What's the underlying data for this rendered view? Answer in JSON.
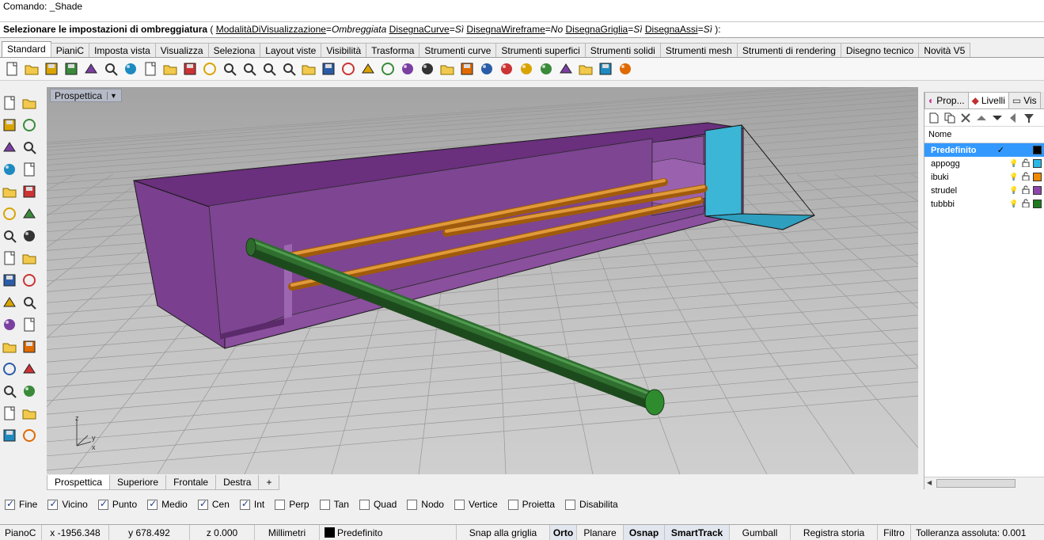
{
  "command": {
    "history": "Comando: _Shade",
    "prompt_bold": "Selezionare le impostazioni di ombreggiatura",
    "open_paren": " ( ",
    "options": [
      {
        "label": "ModalitàDiVisualizzazione",
        "value": "Ombreggiata"
      },
      {
        "label": "DisegnaCurve",
        "value": "Sì"
      },
      {
        "label": "DisegnaWireframe",
        "value": "No"
      },
      {
        "label": "DisegnaGriglia",
        "value": "Sì"
      },
      {
        "label": "DisegnaAssi",
        "value": "Sì"
      }
    ],
    "close_paren": " ):"
  },
  "tabs": [
    "Standard",
    "PianiC",
    "Imposta vista",
    "Visualizza",
    "Seleziona",
    "Layout viste",
    "Visibilità",
    "Trasforma",
    "Strumenti curve",
    "Strumenti superfici",
    "Strumenti solidi",
    "Strumenti mesh",
    "Strumenti di rendering",
    "Disegno tecnico",
    "Novità V5"
  ],
  "toolbar_icons": [
    "new-icon",
    "open-icon",
    "save-icon",
    "print-icon",
    "import-icon",
    "cut-icon",
    "copy-icon",
    "paste-icon",
    "undo-icon",
    "pan-icon",
    "move-view-icon",
    "zoom-icon",
    "zoom-window-icon",
    "zoom-extents-icon",
    "zoom-selected-icon",
    "rotate-view-icon",
    "four-viewports-icon",
    "car-icon",
    "cplane-icon",
    "circle-icon",
    "snap-icon",
    "light-icon",
    "lock-icon",
    "layer-icon",
    "color-wheel-icon",
    "sphere-icon",
    "shaded-sphere-icon",
    "rendered-sphere-icon",
    "cone-icon",
    "gear-icon",
    "grid-icon",
    "help-icon"
  ],
  "viewport": {
    "title": "Prospettica",
    "axis_x": "x",
    "axis_y": "y",
    "axis_z": "z"
  },
  "viewport_tabs": [
    "Prospettica",
    "Superiore",
    "Frontale",
    "Destra"
  ],
  "right_panel": {
    "tabs": [
      "Prop...",
      "Livelli",
      "Vis"
    ],
    "column_header": "Nome",
    "layers": [
      {
        "name": "Predefinito",
        "color": "#000000",
        "current": true
      },
      {
        "name": "appogg",
        "color": "#29b8e6",
        "current": false
      },
      {
        "name": "ibuki",
        "color": "#f08a00",
        "current": false
      },
      {
        "name": "strudel",
        "color": "#8e44ad",
        "current": false
      },
      {
        "name": "tubbbi",
        "color": "#1e7a1e",
        "current": false
      }
    ]
  },
  "osnaps": [
    {
      "label": "Fine",
      "checked": true
    },
    {
      "label": "Vicino",
      "checked": true
    },
    {
      "label": "Punto",
      "checked": true
    },
    {
      "label": "Medio",
      "checked": true
    },
    {
      "label": "Cen",
      "checked": true
    },
    {
      "label": "Int",
      "checked": true
    },
    {
      "label": "Perp",
      "checked": false
    },
    {
      "label": "Tan",
      "checked": false
    },
    {
      "label": "Quad",
      "checked": false
    },
    {
      "label": "Nodo",
      "checked": false
    },
    {
      "label": "Vertice",
      "checked": false
    },
    {
      "label": "Proietta",
      "checked": false
    },
    {
      "label": "Disabilita",
      "checked": false
    }
  ],
  "status": {
    "cplane": "PianoC",
    "x": "x -1956.348",
    "y": "y 678.492",
    "z": "z 0.000",
    "units": "Millimetri",
    "layer": "Predefinito",
    "snap_grid": "Snap alla griglia",
    "ortho": "Orto",
    "planar": "Planare",
    "osnap": "Osnap",
    "smarttrack": "SmartTrack",
    "gumball": "Gumball",
    "history": "Registra storia",
    "filter": "Filtro",
    "tolerance": "Tolleranza assoluta: 0.001"
  }
}
